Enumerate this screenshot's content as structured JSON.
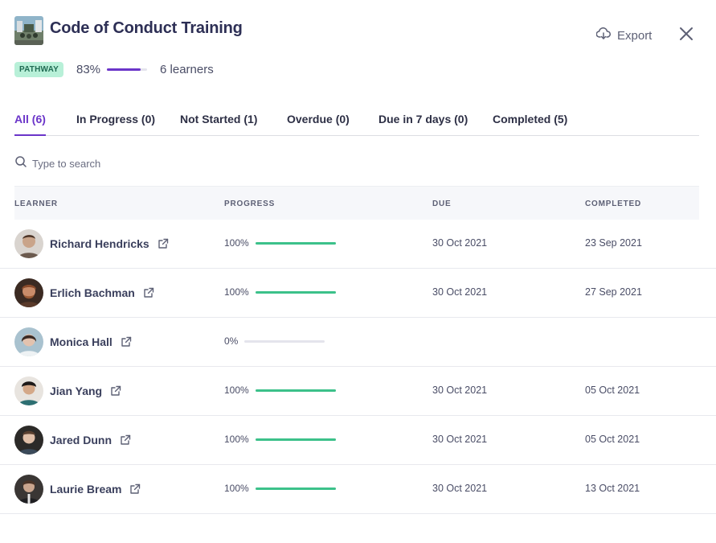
{
  "header": {
    "title": "Code of Conduct Training",
    "thumbnail_icon": "course-thumbnail",
    "export_label": "Export",
    "export_icon": "cloud-download-icon",
    "close_icon": "close-icon"
  },
  "meta": {
    "badge": "PATHWAY",
    "progress_label": "83%",
    "progress_value": 0.83,
    "learners_label": "6 learners"
  },
  "tabs": [
    {
      "label": "All (6)",
      "active": true
    },
    {
      "label": "In Progress (0)",
      "active": false
    },
    {
      "label": "Not Started (1)",
      "active": false
    },
    {
      "label": "Overdue (0)",
      "active": false
    },
    {
      "label": "Due in 7 days (0)",
      "active": false
    },
    {
      "label": "Completed (5)",
      "active": false
    }
  ],
  "search": {
    "placeholder": "Type to search",
    "value": ""
  },
  "table": {
    "headers": {
      "learner": "LEARNER",
      "progress": "PROGRESS",
      "due": "DUE",
      "completed": "COMPLETED"
    },
    "rows": [
      {
        "name": "Richard Hendricks",
        "progress_label": "100%",
        "progress": 1.0,
        "due": "30 Oct 2021",
        "completed": "23 Sep 2021"
      },
      {
        "name": "Erlich Bachman",
        "progress_label": "100%",
        "progress": 1.0,
        "due": "30 Oct 2021",
        "completed": "27 Sep 2021"
      },
      {
        "name": "Monica Hall",
        "progress_label": "0%",
        "progress": 0.0,
        "due": "",
        "completed": ""
      },
      {
        "name": "Jian Yang",
        "progress_label": "100%",
        "progress": 1.0,
        "due": "30 Oct 2021",
        "completed": "05 Oct 2021"
      },
      {
        "name": "Jared Dunn",
        "progress_label": "100%",
        "progress": 1.0,
        "due": "30 Oct 2021",
        "completed": "05 Oct 2021"
      },
      {
        "name": "Laurie Bream",
        "progress_label": "100%",
        "progress": 1.0,
        "due": "30 Oct 2021",
        "completed": "13 Oct 2021"
      }
    ]
  },
  "colors": {
    "accent": "#6b35c9",
    "progress_complete": "#3cc18a",
    "badge_bg": "#b8f0d8"
  }
}
